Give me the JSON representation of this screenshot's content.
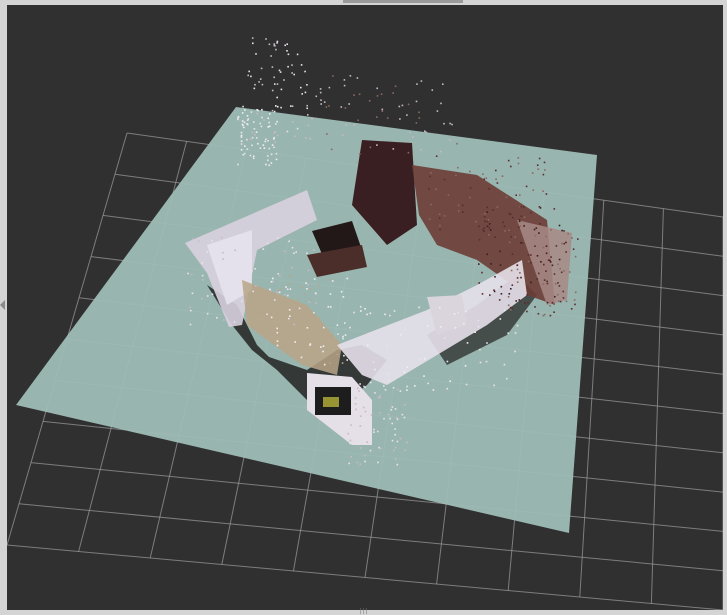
{
  "window": {
    "panel_name": "3d-viewport",
    "splitter_glyph": "|||"
  },
  "scene": {
    "background_color": "#303030",
    "grid_color": "#9e9e9e",
    "floor_plane_color": "#9fbdb6",
    "point_cloud_palette": [
      "#e8e3ec",
      "#c7b9c8",
      "#8a6a60",
      "#5a2c2c",
      "#3a1f1f",
      "#b9a587",
      "#f0f0f0"
    ]
  }
}
